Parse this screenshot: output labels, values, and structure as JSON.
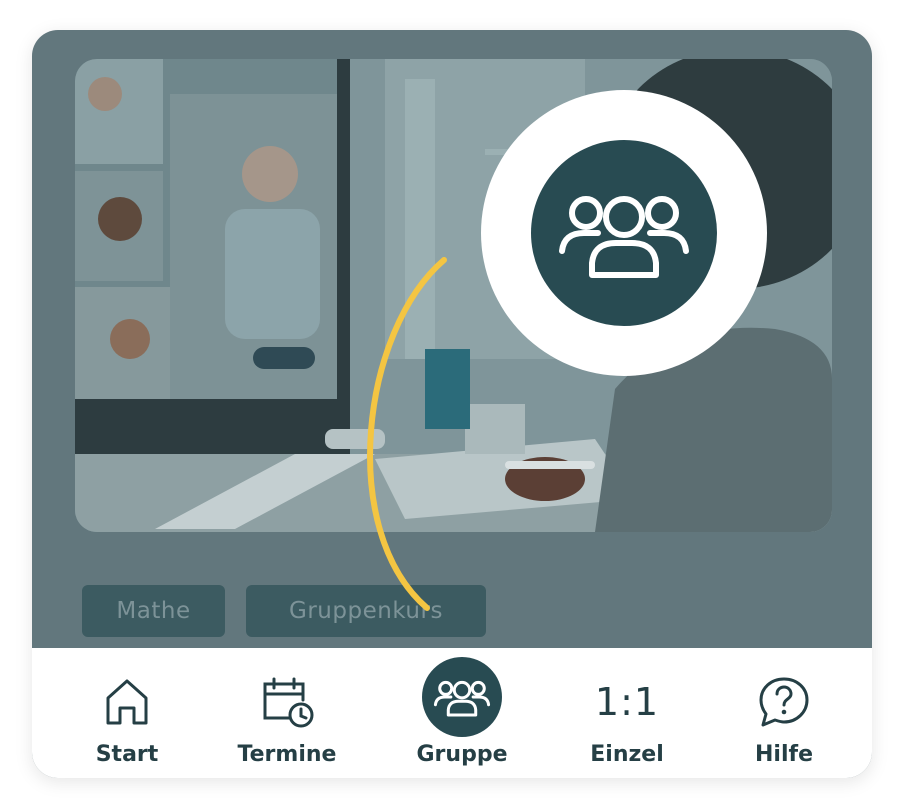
{
  "tags": {
    "subject": "Mathe",
    "course_type": "Gruppenkurs"
  },
  "spotlight": {
    "icon": "group-icon"
  },
  "nav": {
    "items": [
      {
        "label": "Start",
        "icon": "home-icon",
        "active": false
      },
      {
        "label": "Termine",
        "icon": "calendar-clock-icon",
        "active": false
      },
      {
        "label": "Gruppe",
        "icon": "group-icon",
        "active": true
      },
      {
        "label": "Einzel",
        "icon": "one-to-one-icon",
        "icon_text": "1:1",
        "active": false
      },
      {
        "label": "Hilfe",
        "icon": "help-bubble-icon",
        "active": false
      }
    ]
  },
  "colors": {
    "overlay": "#62777d",
    "dark_teal": "#284b52",
    "tag_bg": "#3c5b61",
    "accent_arc": "#f4c542",
    "nav_text": "#253f45"
  }
}
